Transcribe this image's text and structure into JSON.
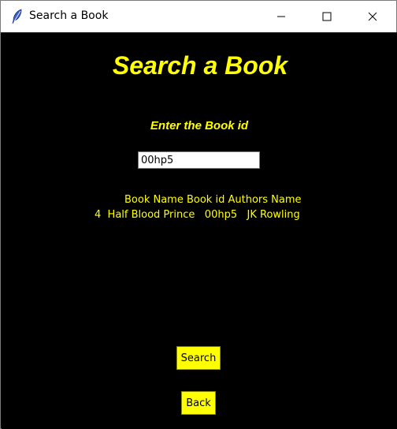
{
  "window": {
    "title": "Search a Book",
    "icon": "feather-icon",
    "controls": [
      "minimize-icon",
      "maximize-icon",
      "close-icon"
    ]
  },
  "main": {
    "heading": "Search a Book",
    "prompt": "Enter the Book id",
    "book_id_value": "00hp5",
    "results": {
      "headers": [
        "Book Name",
        "Book id",
        "Authors Name"
      ],
      "rows": [
        {
          "index": "4",
          "book_name": "Half Blood Prince",
          "book_id": "00hp5",
          "author": "JK Rowling"
        }
      ]
    },
    "search_label": "Search",
    "back_label": "Back"
  },
  "colors": {
    "background": "#000000",
    "accent": "#ffff00",
    "titlebar": "#ffffff"
  }
}
